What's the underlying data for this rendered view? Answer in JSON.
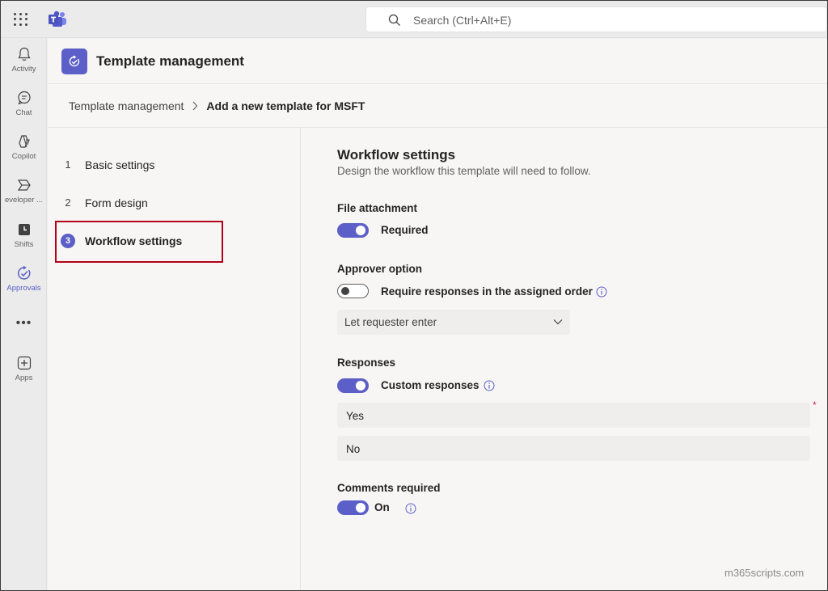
{
  "topbar": {
    "search_placeholder": "Search (Ctrl+Alt+E)"
  },
  "rail": {
    "items": [
      {
        "label": "Activity",
        "icon": "bell-icon"
      },
      {
        "label": "Chat",
        "icon": "chat-icon"
      },
      {
        "label": "Copilot",
        "icon": "copilot-icon"
      },
      {
        "label": "eveloper ...",
        "icon": "developer-portal-icon"
      },
      {
        "label": "Shifts",
        "icon": "shifts-icon"
      },
      {
        "label": "Approvals",
        "icon": "approvals-icon"
      },
      {
        "label": "Apps",
        "icon": "add-apps-icon"
      }
    ],
    "more_label": "•••",
    "active_color": "#5b5fc7"
  },
  "header": {
    "title": "Template management"
  },
  "breadcrumb": {
    "parent": "Template management",
    "current": "Add a new template for MSFT"
  },
  "steps": [
    {
      "num": "1",
      "label": "Basic settings"
    },
    {
      "num": "2",
      "label": "Form design"
    },
    {
      "num": "3",
      "label": "Workflow settings"
    }
  ],
  "workflow": {
    "title": "Workflow settings",
    "description": "Design the workflow this template will need to follow.",
    "file_attachment": {
      "label": "File attachment",
      "toggle_label": "Required",
      "on": true
    },
    "approver_option": {
      "label": "Approver option",
      "toggle_label": "Require responses in the assigned order",
      "on": false,
      "dropdown_value": "Let requester enter"
    },
    "responses": {
      "label": "Responses",
      "toggle_label": "Custom responses",
      "on": true,
      "options": [
        "Yes",
        "No"
      ]
    },
    "comments": {
      "label": "Comments required",
      "toggle_label": "On",
      "on": true
    }
  },
  "watermark": "m365scripts.com",
  "colors": {
    "accent": "#5b5fc7",
    "highlight": "#b3001b"
  }
}
